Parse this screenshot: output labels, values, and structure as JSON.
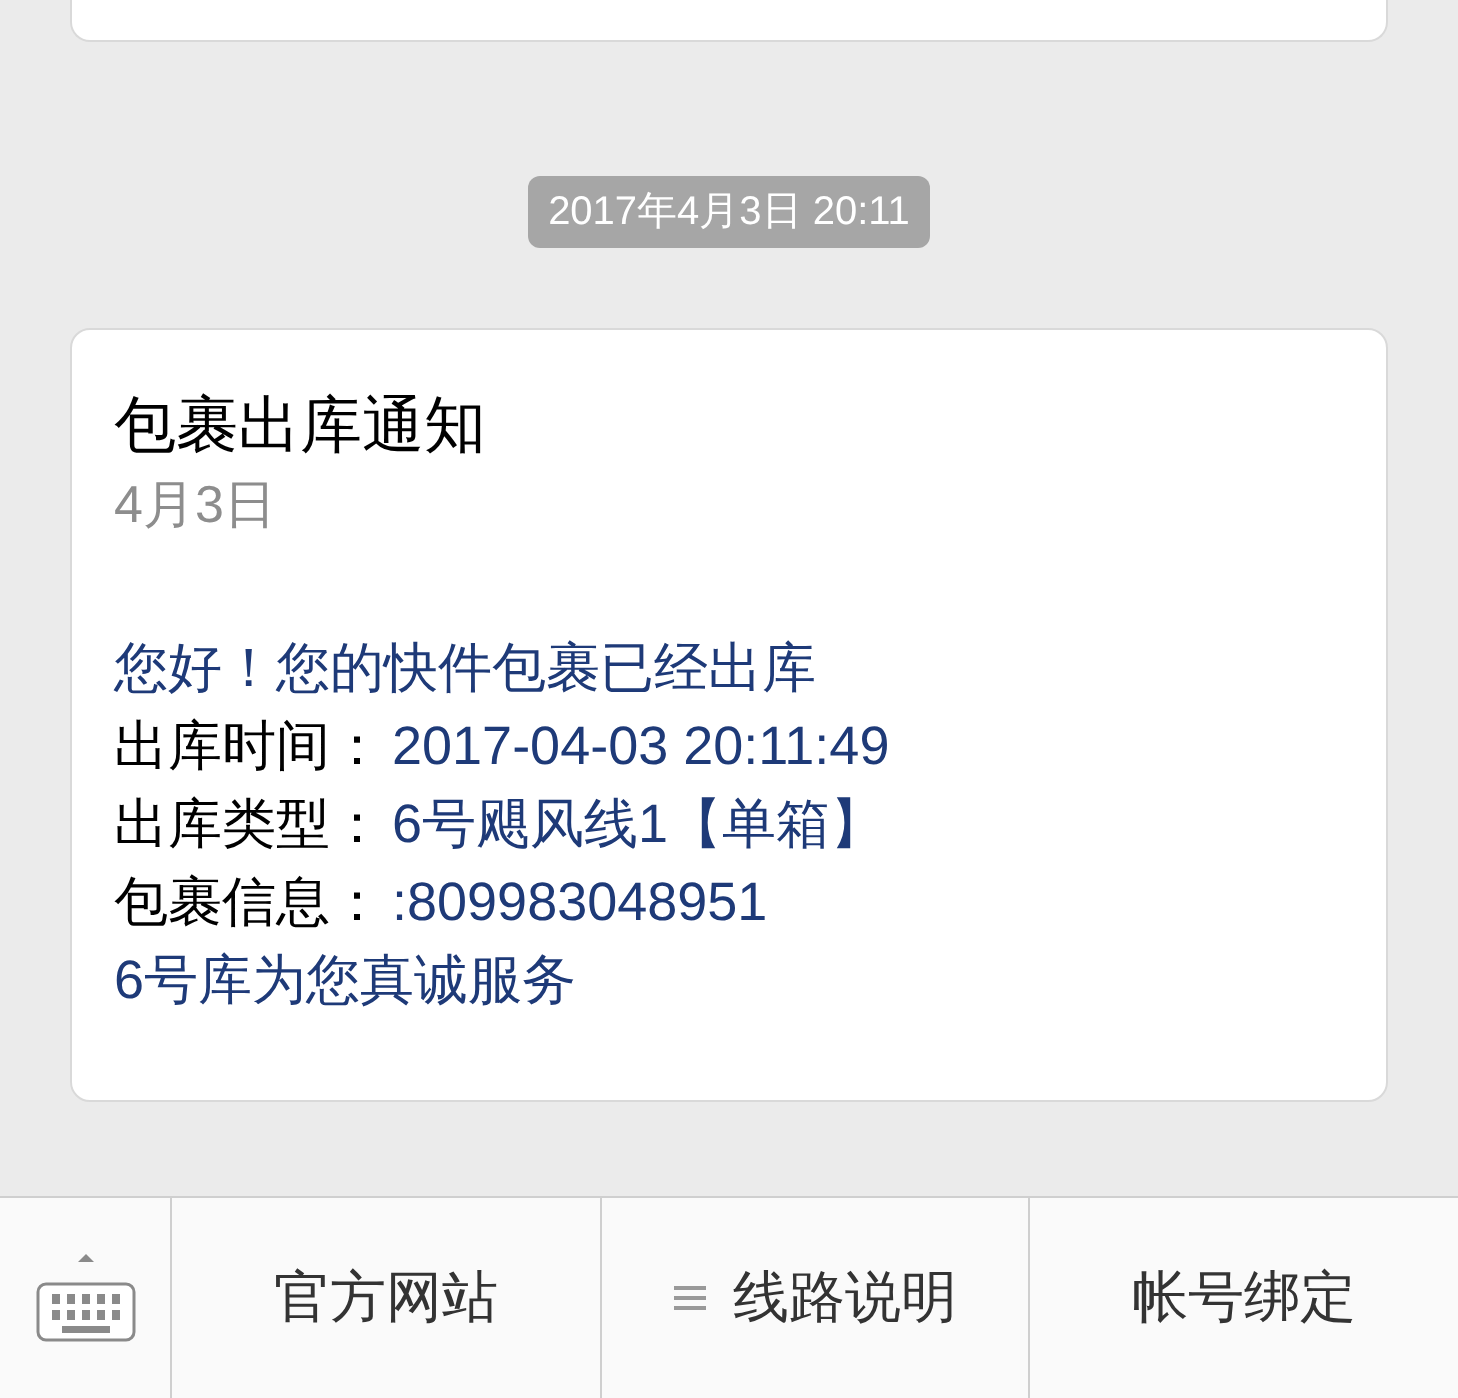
{
  "timestamp": "2017年4月3日 20:11",
  "message": {
    "title": "包裹出库通知",
    "date": "4月3日",
    "lines": [
      {
        "kind": "text",
        "text": "您好！您的快件包裹已经出库"
      },
      {
        "kind": "field",
        "label": "出库时间：",
        "value": "2017-04-03 20:11:49"
      },
      {
        "kind": "field",
        "label": "出库类型：",
        "value": "6号飓风线1【单箱】"
      },
      {
        "kind": "field",
        "label": "包裹信息：",
        "value": ":809983048951"
      },
      {
        "kind": "text",
        "text": "6号库为您真诚服务"
      }
    ]
  },
  "menu": [
    {
      "label": "官方网站",
      "submenu": false
    },
    {
      "label": "线路说明",
      "submenu": true
    },
    {
      "label": "帐号绑定",
      "submenu": false
    }
  ]
}
